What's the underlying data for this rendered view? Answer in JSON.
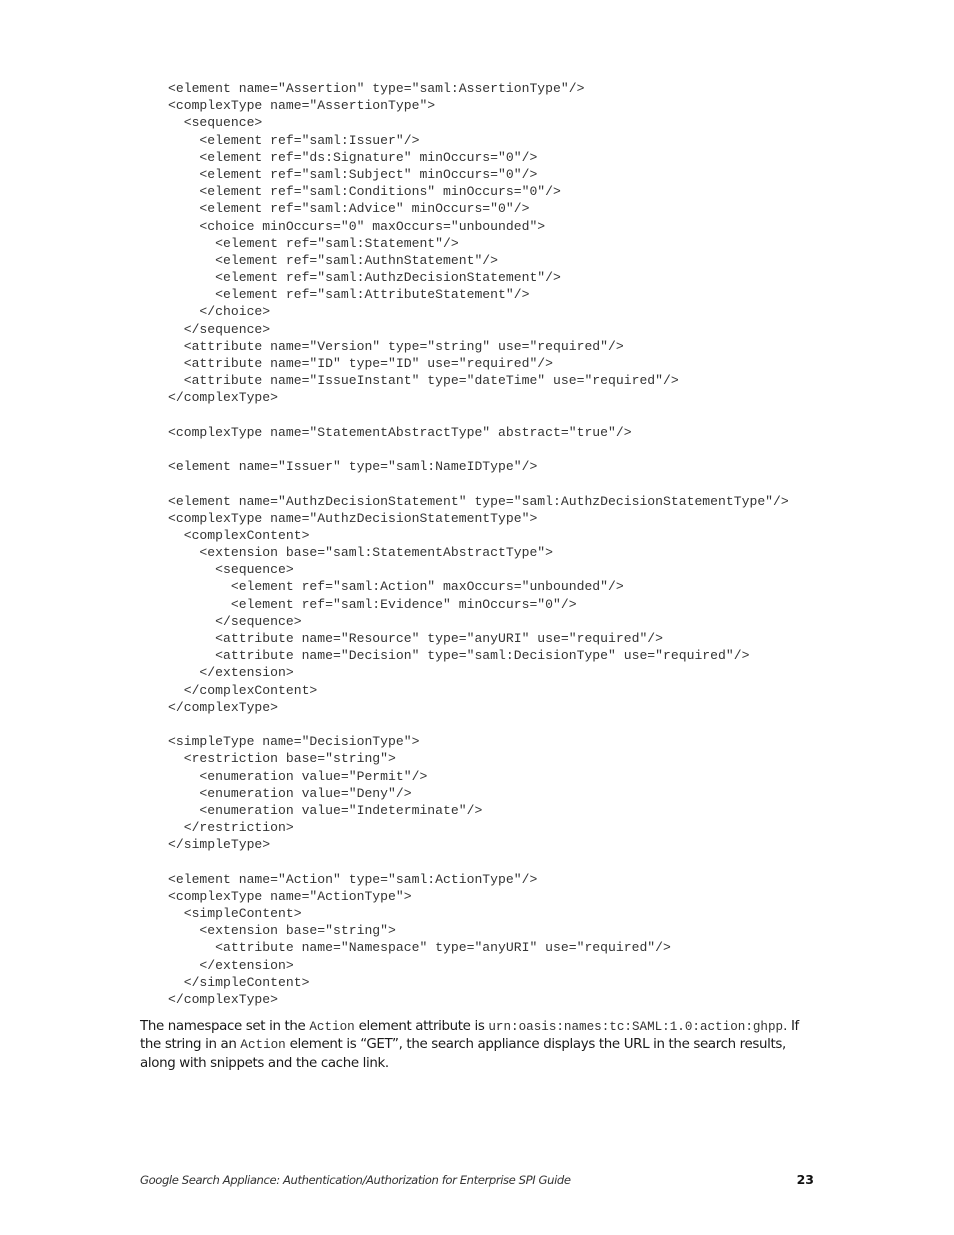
{
  "code_block": {
    "lines": [
      "<element name=\"Assertion\" type=\"saml:AssertionType\"/>",
      "<complexType name=\"AssertionType\">",
      "  <sequence>",
      "    <element ref=\"saml:Issuer\"/>",
      "    <element ref=\"ds:Signature\" minOccurs=\"0\"/>",
      "    <element ref=\"saml:Subject\" minOccurs=\"0\"/>",
      "    <element ref=\"saml:Conditions\" minOccurs=\"0\"/>",
      "    <element ref=\"saml:Advice\" minOccurs=\"0\"/>",
      "    <choice minOccurs=\"0\" maxOccurs=\"unbounded\">",
      "      <element ref=\"saml:Statement\"/>",
      "      <element ref=\"saml:AuthnStatement\"/>",
      "      <element ref=\"saml:AuthzDecisionStatement\"/>",
      "      <element ref=\"saml:AttributeStatement\"/>",
      "    </choice>",
      "  </sequence>",
      "  <attribute name=\"Version\" type=\"string\" use=\"required\"/>",
      "  <attribute name=\"ID\" type=\"ID\" use=\"required\"/>",
      "  <attribute name=\"IssueInstant\" type=\"dateTime\" use=\"required\"/>",
      "</complexType>",
      "",
      "<complexType name=\"StatementAbstractType\" abstract=\"true\"/>",
      "",
      "<element name=\"Issuer\" type=\"saml:NameIDType\"/>",
      "",
      "<element name=\"AuthzDecisionStatement\" type=\"saml:AuthzDecisionStatementType\"/>",
      "<complexType name=\"AuthzDecisionStatementType\">",
      "  <complexContent>",
      "    <extension base=\"saml:StatementAbstractType\">",
      "      <sequence>",
      "        <element ref=\"saml:Action\" maxOccurs=\"unbounded\"/>",
      "        <element ref=\"saml:Evidence\" minOccurs=\"0\"/>",
      "      </sequence>",
      "      <attribute name=\"Resource\" type=\"anyURI\" use=\"required\"/>",
      "      <attribute name=\"Decision\" type=\"saml:DecisionType\" use=\"required\"/>",
      "    </extension>",
      "  </complexContent>",
      "</complexType>",
      "",
      "<simpleType name=\"DecisionType\">",
      "  <restriction base=\"string\">",
      "    <enumeration value=\"Permit\"/>",
      "    <enumeration value=\"Deny\"/>",
      "    <enumeration value=\"Indeterminate\"/>",
      "  </restriction>",
      "</simpleType>",
      "",
      "<element name=\"Action\" type=\"saml:ActionType\"/>",
      "<complexType name=\"ActionType\">",
      "  <simpleContent>",
      "    <extension base=\"string\">",
      "      <attribute name=\"Namespace\" type=\"anyURI\" use=\"required\"/>",
      "    </extension>",
      "  </simpleContent>",
      "</complexType>"
    ]
  },
  "paragraph": {
    "s1_text1": "The namespace set in the ",
    "s1_code1": "Action",
    "s1_text2": " element attribute is ",
    "s1_code2": "urn:oasis:names:tc:SAML:1.0:action:ghpp",
    "s1_text3": ".",
    "s2_text1": " If the string in an ",
    "s2_code1": "Action",
    "s2_text2": " element is “GET”, the search appliance displays the URL in the search results, along with snippets and the cache link."
  },
  "footer": {
    "title": "Google Search Appliance: Authentication/Authorization for Enterprise SPI Guide",
    "page_number": "23"
  }
}
